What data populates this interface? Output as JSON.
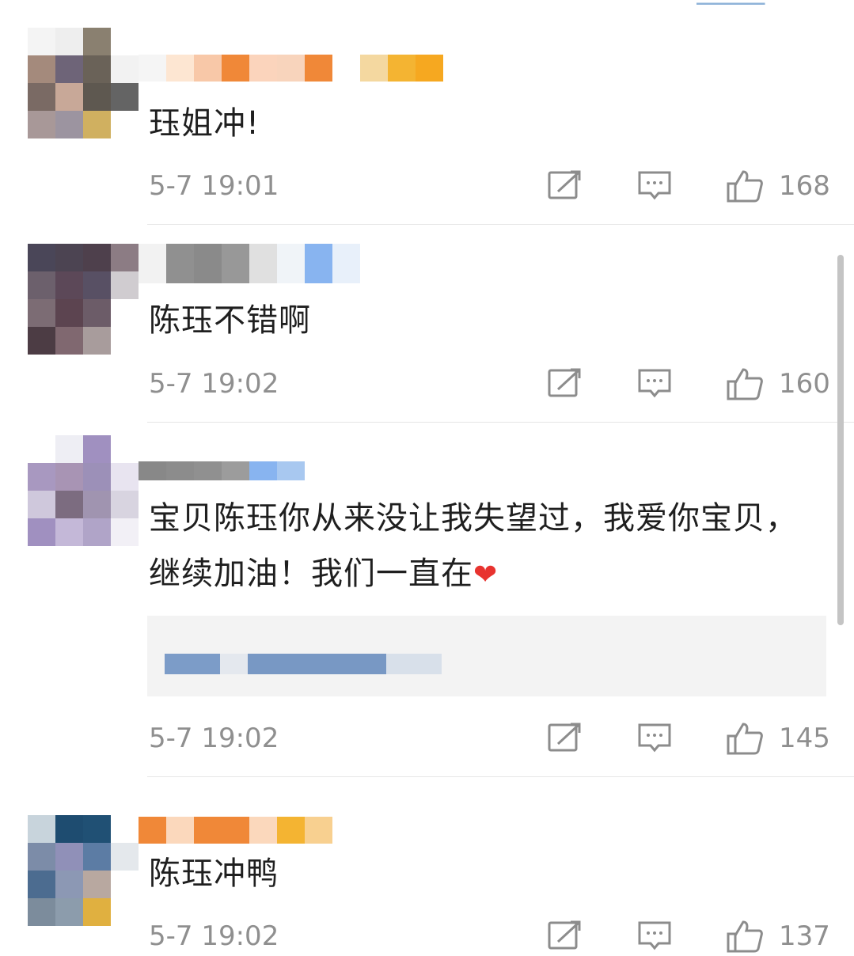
{
  "comments": [
    {
      "text": "珏姐冲!",
      "time": "5-7 19:01",
      "likes": "168",
      "avatar_colors": [
        "#f4f4f4",
        "#eeeeee",
        "#8a8070",
        "#ffffff",
        "#a48a7c",
        "#6e6478",
        "#6a6258",
        "#f2f2f2",
        "#7a6a64",
        "#c8a898",
        "#5e5850",
        "#646464",
        "#a89898",
        "#9c94a0",
        "#d0b060",
        "#ffffff"
      ],
      "name_colors": [
        "#f5f5f5",
        "#fde6d2",
        "#f8c8a8",
        "#f08838",
        "#fbd4bc",
        "#f8d4bc",
        "#f08838",
        "#ffffff",
        "#f4d8a0",
        "#f4b432",
        "#f6a820"
      ]
    },
    {
      "text": "陈珏不错啊",
      "time": "5-7 19:02",
      "likes": "160",
      "avatar_colors": [
        "#4a4658",
        "#4c4452",
        "#4e404c",
        "#8c7c84",
        "#6c606c",
        "#5c4858",
        "#585064",
        "#d0ccd0",
        "#7c6c74",
        "#5c4450",
        "#6c5c68",
        "#ffffff",
        "#4c3c44",
        "#806870",
        "#a89c9c",
        "#ffffff"
      ],
      "name_colors": [
        "#f2f2f2",
        "#909090",
        "#8a8a8a",
        "#989898",
        "#e0e0e0",
        "#f0f4f8",
        "#88b4f0",
        "#e8f0fa"
      ]
    },
    {
      "text": "宝贝陈珏你从来没让我失望过，我爱你宝贝，继续加油！我们一直在",
      "heart": "❤",
      "time": "5-7 19:02",
      "likes": "145",
      "avatar_colors": [
        "#ffffff",
        "#eeeef4",
        "#a090c0",
        "#ffffff",
        "#a898c0",
        "#a894b4",
        "#9c90b8",
        "#e8e4f0",
        "#cfc8dc",
        "#7c6c80",
        "#a094b0",
        "#d8d4e0",
        "#a090c0",
        "#c4b8d8",
        "#b0a4c8",
        "#f2f0f6"
      ],
      "name_colors": [
        "#888888",
        "#8c8c8c",
        "#909090",
        "#9c9c9c",
        "#88b4f0",
        "#a8c8f0"
      ],
      "reply_colors": [
        "#7c9cc8",
        "#e4e8ee",
        "#7898c4",
        "#d8e0ea"
      ]
    },
    {
      "text": "陈珏冲鸭",
      "time": "5-7 19:02",
      "likes": "137",
      "avatar_colors": [
        "#c8d4dc",
        "#1e4c70",
        "#205074",
        "#ffffff",
        "#7c8ca8",
        "#9090b8",
        "#5c7ca4",
        "#e4e8ec",
        "#4c6c90",
        "#8c98b4",
        "#b8a8a0",
        "#ffffff",
        "#7c8c9c",
        "#8c9cac",
        "#e0b040",
        "#ffffff"
      ],
      "name_colors": [
        "#f08838",
        "#fbd8bc",
        "#f08838",
        "#f08838",
        "#fbd8bc",
        "#f4b432",
        "#f8d090"
      ]
    }
  ]
}
